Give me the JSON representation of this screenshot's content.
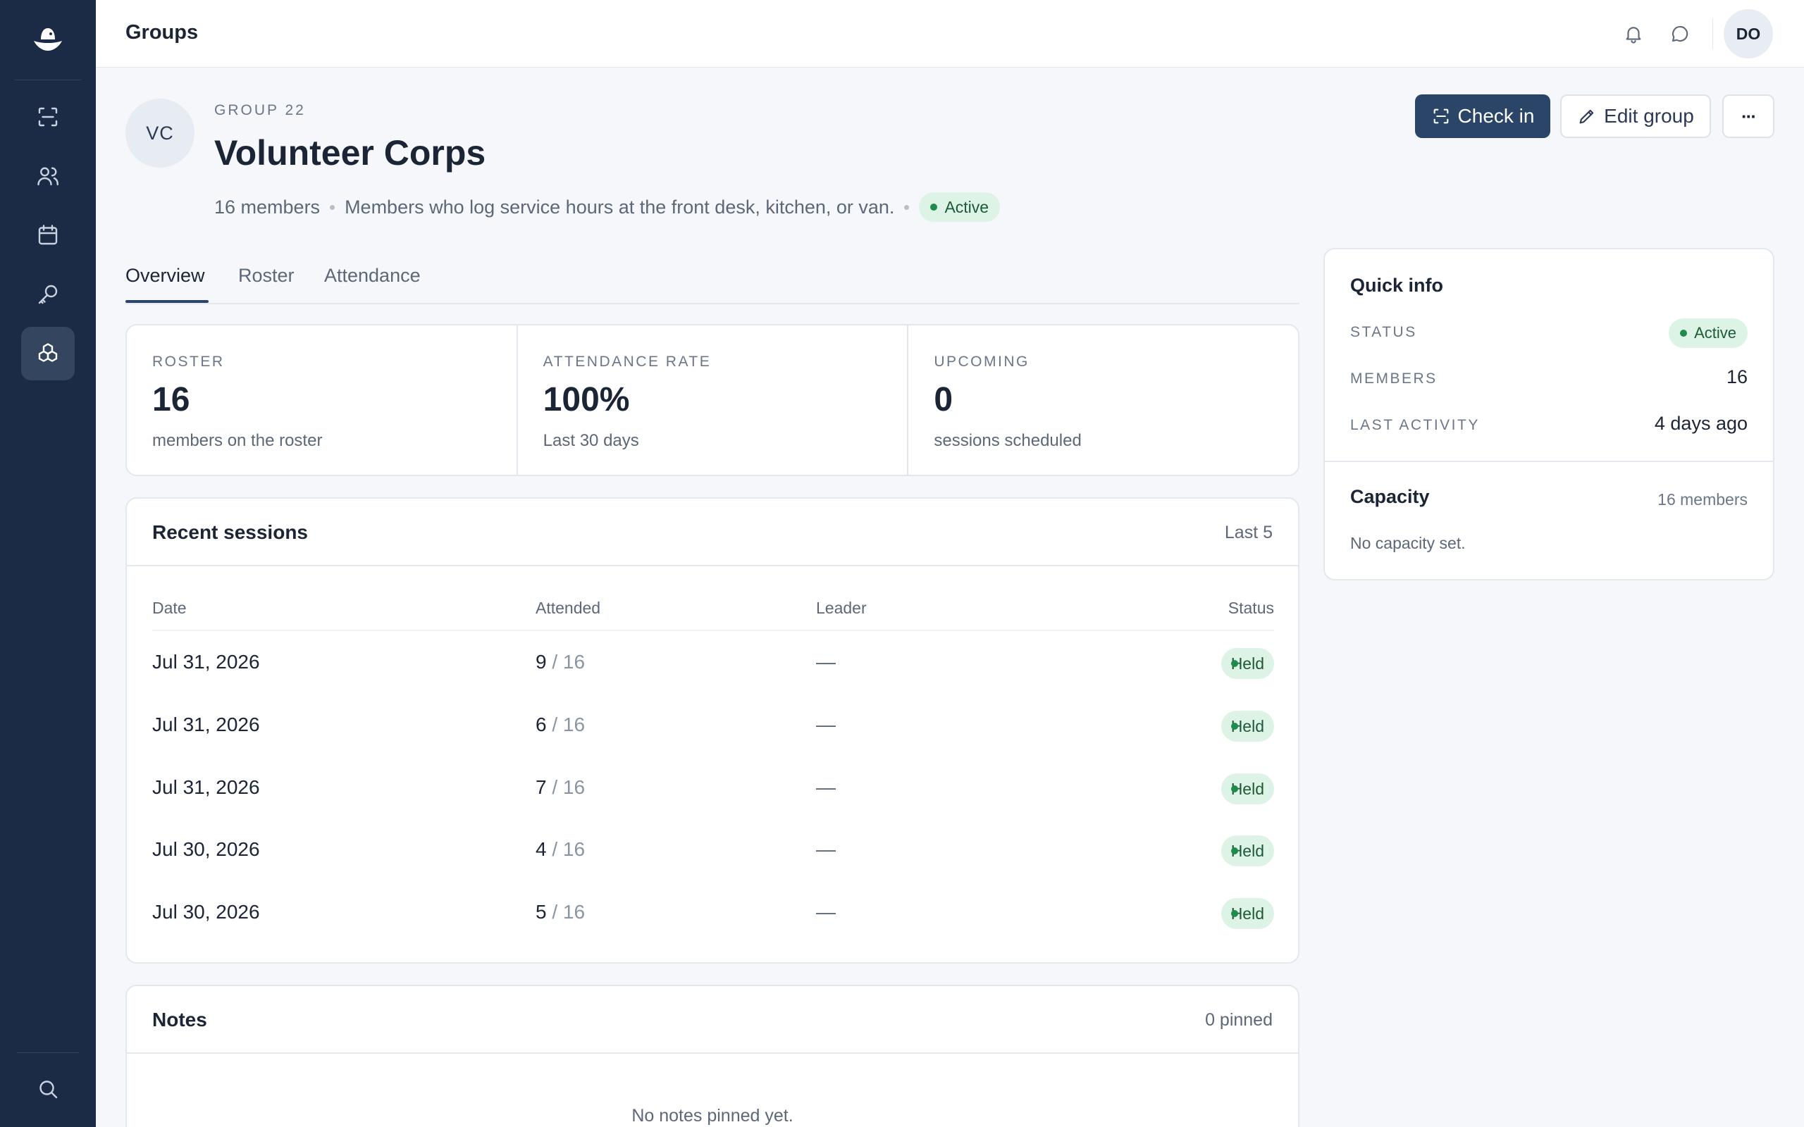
{
  "topbar": {
    "title": "Groups",
    "avatar_initials": "DO"
  },
  "sidebar": {
    "items": [
      {
        "name": "scan-icon"
      },
      {
        "name": "users-icon"
      },
      {
        "name": "calendar-icon"
      },
      {
        "name": "key-icon"
      },
      {
        "name": "groups-icon",
        "active": true
      }
    ],
    "bottom": {
      "name": "search-icon"
    }
  },
  "group": {
    "avatar_initials": "VC",
    "eyebrow": "GROUP 22",
    "title": "Volunteer Corps",
    "members_text": "16 members",
    "description": "Members who log service hours at the front desk, kitchen, or van.",
    "status": "Active"
  },
  "actions": {
    "check_in": "Check in",
    "edit_group": "Edit group",
    "more": "···"
  },
  "tabs": [
    {
      "label": "Overview",
      "active": true
    },
    {
      "label": "Roster"
    },
    {
      "label": "Attendance"
    }
  ],
  "stats": [
    {
      "label": "ROSTER",
      "value": "16",
      "sub": "members on the roster"
    },
    {
      "label": "ATTENDANCE RATE",
      "value": "100%",
      "sub": "Last 30 days"
    },
    {
      "label": "UPCOMING",
      "value": "0",
      "sub": "sessions scheduled"
    }
  ],
  "sessions": {
    "title": "Recent sessions",
    "right": "Last 5",
    "columns": {
      "date": "Date",
      "attended": "Attended",
      "leader": "Leader",
      "status": "Status"
    },
    "rows": [
      {
        "date": "Jul 31, 2026",
        "attended": "9",
        "of": "/ 16",
        "leader": "—",
        "status": "Held"
      },
      {
        "date": "Jul 31, 2026",
        "attended": "6",
        "of": "/ 16",
        "leader": "—",
        "status": "Held"
      },
      {
        "date": "Jul 31, 2026",
        "attended": "7",
        "of": "/ 16",
        "leader": "—",
        "status": "Held"
      },
      {
        "date": "Jul 30, 2026",
        "attended": "4",
        "of": "/ 16",
        "leader": "—",
        "status": "Held"
      },
      {
        "date": "Jul 30, 2026",
        "attended": "5",
        "of": "/ 16",
        "leader": "—",
        "status": "Held"
      }
    ]
  },
  "notes": {
    "title": "Notes",
    "right": "0 pinned",
    "empty": "No notes pinned yet."
  },
  "quick_info": {
    "title": "Quick info",
    "status_label": "STATUS",
    "status_value": "Active",
    "members_label": "MEMBERS",
    "members_value": "16",
    "activity_label": "LAST ACTIVITY",
    "activity_value": "4 days ago",
    "capacity_title": "Capacity",
    "capacity_right": "16 members",
    "capacity_sub": "No capacity set."
  },
  "colors": {
    "sidebar": "#1c2b45",
    "primary": "#2a4567",
    "success_bg": "#dcf3e5",
    "success_dot": "#1f8a4c"
  }
}
